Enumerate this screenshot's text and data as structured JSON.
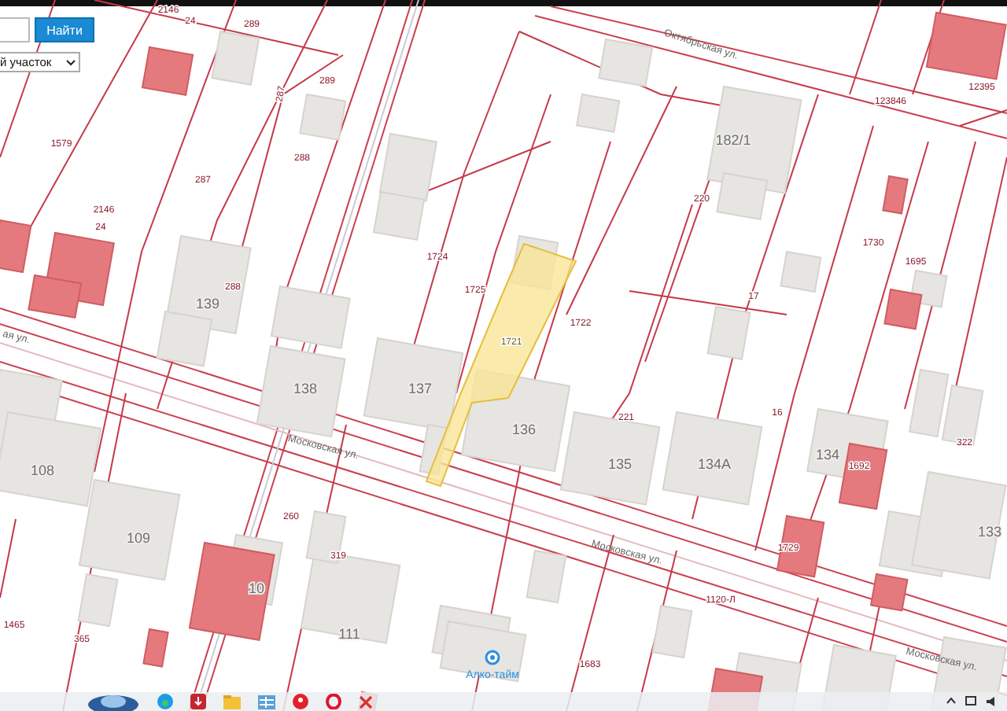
{
  "search": {
    "button": "Найти",
    "dropdown": "й участок"
  },
  "map": {
    "streets": [
      "Октябрьская ул.",
      "Московская ул.",
      "Московская ул.",
      "Московская ул.",
      "ая ул."
    ],
    "parcels": [
      {
        "text": "2146",
        "selected": false
      },
      {
        "text": "24",
        "selected": false
      },
      {
        "text": "289",
        "selected": false
      },
      {
        "text": "289",
        "selected": false
      },
      {
        "text": "287",
        "selected": false
      },
      {
        "text": "1579",
        "selected": false
      },
      {
        "text": "288",
        "selected": false
      },
      {
        "text": "287",
        "selected": false
      },
      {
        "text": "2146",
        "selected": false
      },
      {
        "text": "24",
        "selected": false
      },
      {
        "text": "288",
        "selected": false
      },
      {
        "text": "1724",
        "selected": false
      },
      {
        "text": "1725",
        "selected": false
      },
      {
        "text": "1721",
        "selected": true
      },
      {
        "text": "1722",
        "selected": false
      },
      {
        "text": "220",
        "selected": false
      },
      {
        "text": "123846",
        "selected": false
      },
      {
        "text": "12395",
        "selected": false
      },
      {
        "text": "1730",
        "selected": false
      },
      {
        "text": "1695",
        "selected": false
      },
      {
        "text": "17",
        "selected": false
      },
      {
        "text": "221",
        "selected": false
      },
      {
        "text": "16",
        "selected": false
      },
      {
        "text": "322",
        "selected": false
      },
      {
        "text": "1692",
        "selected": false
      },
      {
        "text": "1729",
        "selected": false
      },
      {
        "text": "260",
        "selected": false
      },
      {
        "text": "319",
        "selected": false
      },
      {
        "text": "1465",
        "selected": false
      },
      {
        "text": "365",
        "selected": false
      },
      {
        "text": "1120-Л",
        "selected": false
      },
      {
        "text": "1683",
        "selected": false
      }
    ],
    "buildings": [
      "182/1",
      "139",
      "138",
      "137",
      "136",
      "135",
      "134А",
      "134",
      "133",
      "108",
      "109",
      "10",
      "111"
    ],
    "poi": "Алко-тайм"
  }
}
